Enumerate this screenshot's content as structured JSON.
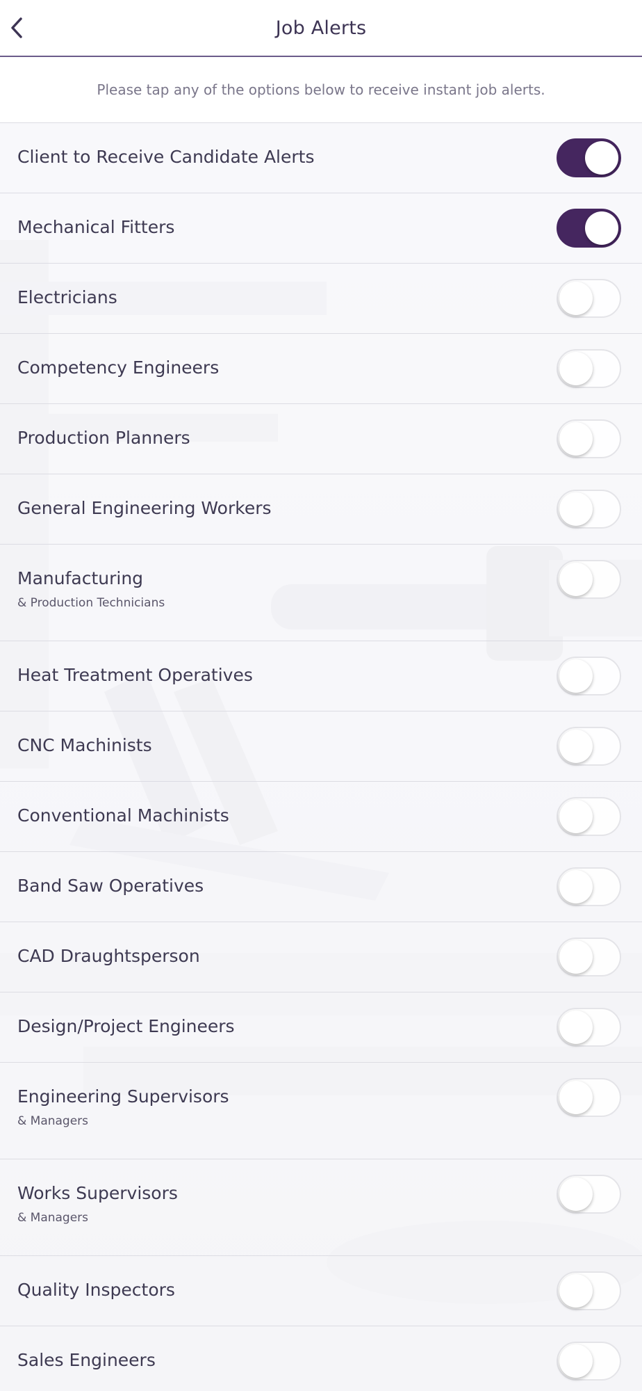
{
  "header": {
    "title": "Job Alerts",
    "back_icon": "chevron-left-icon"
  },
  "hint": "Please tap any of the options below to receive instant job alerts.",
  "colors": {
    "accent": "#45265f",
    "header_border": "#6b5b8a",
    "toggle_off_bg": "#ffffff"
  },
  "alerts": [
    {
      "label": "Client to Receive Candidate Alerts",
      "sub": "",
      "enabled": true
    },
    {
      "label": "Mechanical Fitters",
      "sub": "",
      "enabled": true
    },
    {
      "label": "Electricians",
      "sub": "",
      "enabled": false
    },
    {
      "label": "Competency Engineers",
      "sub": "",
      "enabled": false
    },
    {
      "label": "Production Planners",
      "sub": "",
      "enabled": false
    },
    {
      "label": "General Engineering Workers",
      "sub": "",
      "enabled": false
    },
    {
      "label": "Manufacturing",
      "sub": "& Production Technicians",
      "enabled": false
    },
    {
      "label": "Heat Treatment Operatives",
      "sub": "",
      "enabled": false
    },
    {
      "label": "CNC Machinists",
      "sub": "",
      "enabled": false
    },
    {
      "label": "Conventional Machinists",
      "sub": "",
      "enabled": false
    },
    {
      "label": "Band Saw Operatives",
      "sub": "",
      "enabled": false
    },
    {
      "label": "CAD Draughtsperson",
      "sub": "",
      "enabled": false
    },
    {
      "label": "Design/Project Engineers",
      "sub": "",
      "enabled": false
    },
    {
      "label": "Engineering Supervisors",
      "sub": "& Managers",
      "enabled": false
    },
    {
      "label": "Works Supervisors",
      "sub": "& Managers",
      "enabled": false
    },
    {
      "label": "Quality Inspectors",
      "sub": "",
      "enabled": false
    },
    {
      "label": "Sales Engineers",
      "sub": "",
      "enabled": false
    }
  ]
}
